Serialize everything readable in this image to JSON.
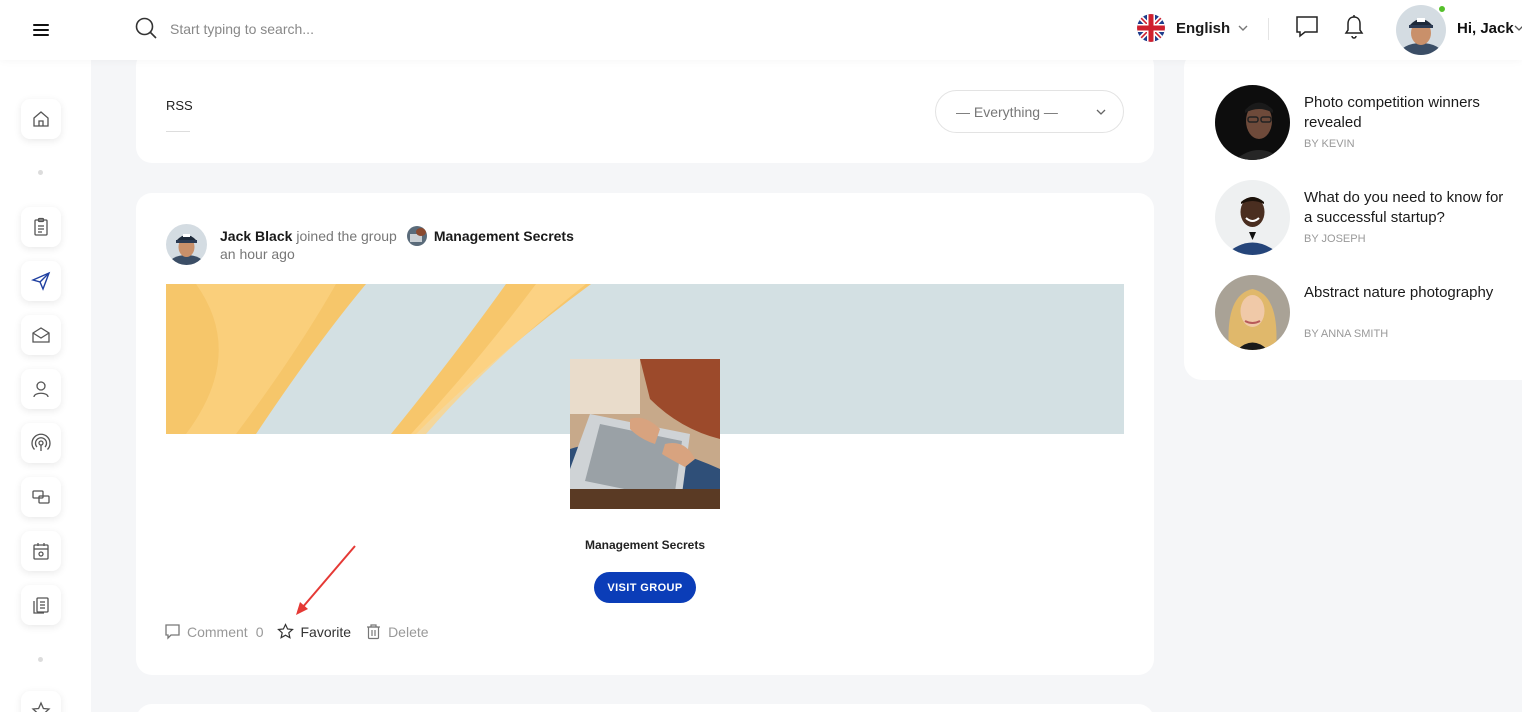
{
  "header": {
    "search_placeholder": "Start typing to search...",
    "language": "English",
    "greeting": "Hi, Jack"
  },
  "feed": {
    "tab": "RSS",
    "filter_value": "— Everything —",
    "activity": {
      "user": "Jack Black",
      "action": "joined the group",
      "group": "Management Secrets",
      "time": "an hour ago",
      "group_card_name": "Management Secrets",
      "visit_button": "VISIT GROUP",
      "comment_label": "Comment",
      "comment_count": "0",
      "favorite_label": "Favorite",
      "delete_label": "Delete"
    }
  },
  "widget": {
    "posts": [
      {
        "title": "Photo competition winners revealed",
        "by": "BY KEVIN"
      },
      {
        "title": "What do you need to know for a successful startup?",
        "by": "BY JOSEPH"
      },
      {
        "title": "Abstract nature photography",
        "by": "BY ANNA SMITH"
      }
    ]
  },
  "colors": {
    "accent": "#0b3db8",
    "online": "#55c02b",
    "annotation": "#e53935"
  },
  "icons": [
    "menu-icon",
    "search-icon",
    "uk-flag-icon",
    "chevron-down-icon",
    "message-icon",
    "bell-icon",
    "home-icon",
    "clipboard-icon",
    "send-icon",
    "mail-icon",
    "user-icon",
    "broadcast-icon",
    "chat-icon",
    "calendar-icon",
    "document-icon",
    "star-icon",
    "comment-icon",
    "trash-icon"
  ]
}
